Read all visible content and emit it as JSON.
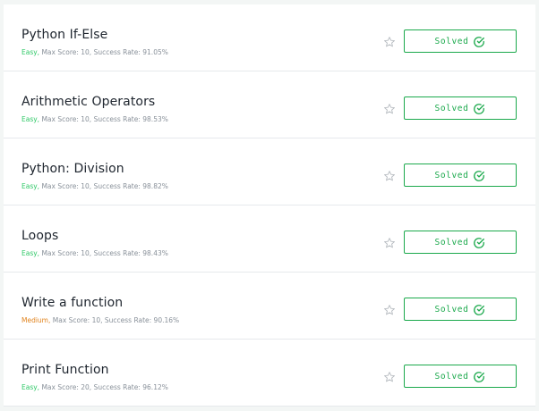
{
  "challenges": [
    {
      "title": "Python If-Else",
      "difficulty": "Easy,",
      "difficulty_level": "easy",
      "details": " Max Score: 10, Success Rate: 91.05%",
      "status_label": "Solved"
    },
    {
      "title": "Arithmetic Operators",
      "difficulty": "Easy,",
      "difficulty_level": "easy",
      "details": " Max Score: 10, Success Rate: 98.53%",
      "status_label": "Solved"
    },
    {
      "title": "Python: Division",
      "difficulty": "Easy,",
      "difficulty_level": "easy",
      "details": " Max Score: 10, Success Rate: 98.82%",
      "status_label": "Solved"
    },
    {
      "title": "Loops",
      "difficulty": "Easy,",
      "difficulty_level": "easy",
      "details": " Max Score: 10, Success Rate: 98.43%",
      "status_label": "Solved"
    },
    {
      "title": "Write a function",
      "difficulty": "Medium,",
      "difficulty_level": "medium",
      "details": " Max Score: 10, Success Rate: 90.16%",
      "status_label": "Solved"
    },
    {
      "title": "Print Function",
      "difficulty": "Easy,",
      "difficulty_level": "easy",
      "details": " Max Score: 20, Success Rate: 96.12%",
      "status_label": "Solved"
    }
  ],
  "colors": {
    "accent_green": "#1ba94c",
    "easy": "#2ec866",
    "medium": "#e1841f",
    "star_outline": "#b7bcc1"
  },
  "icons": {
    "bookmark": "star-outline-icon",
    "solved": "check-circle-icon"
  }
}
